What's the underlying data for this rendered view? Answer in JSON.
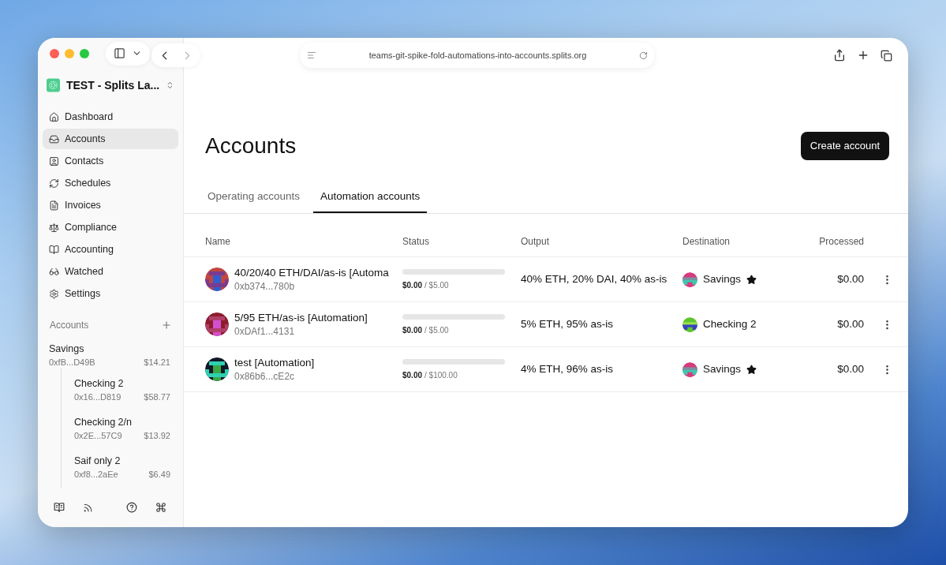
{
  "browser": {
    "url": "teams-git-spike-fold-automations-into-accounts.splits.org"
  },
  "workspace": {
    "name": "TEST - Splits La..."
  },
  "nav": [
    {
      "label": "Dashboard",
      "selected": false
    },
    {
      "label": "Accounts",
      "selected": true
    },
    {
      "label": "Contacts",
      "selected": false
    },
    {
      "label": "Schedules",
      "selected": false
    },
    {
      "label": "Invoices",
      "selected": false
    },
    {
      "label": "Compliance",
      "selected": false
    },
    {
      "label": "Accounting",
      "selected": false
    },
    {
      "label": "Watched",
      "selected": false
    },
    {
      "label": "Settings",
      "selected": false
    }
  ],
  "accounts_section": {
    "title": "Accounts",
    "items": [
      {
        "name": "Savings",
        "address": "0xfB...D49B",
        "balance": "$14.21",
        "children": [
          {
            "name": "Checking 2",
            "address": "0x16...D819",
            "balance": "$58.77"
          },
          {
            "name": "Checking 2/n",
            "address": "0x2E...57C9",
            "balance": "$13.92"
          },
          {
            "name": "Saif only 2",
            "address": "0xf8...2aEe",
            "balance": "$6.49"
          }
        ]
      }
    ]
  },
  "page": {
    "title": "Accounts",
    "primary_button": "Create account"
  },
  "tabs": [
    {
      "label": "Operating accounts",
      "selected": false
    },
    {
      "label": "Automation accounts",
      "selected": true
    }
  ],
  "table": {
    "columns": [
      "Name",
      "Status",
      "Output",
      "Destination",
      "Processed"
    ],
    "rows": [
      {
        "name": "40/20/40 ETH/DAI/as-is [Automa",
        "address": "0xb374...780b",
        "spent": "$0.00",
        "limit": "/ $5.00",
        "level": 0,
        "output": "40% ETH, 20% DAI, 40% as-is",
        "destination": "Savings",
        "starred": true,
        "processed": "$0.00"
      },
      {
        "name": "5/95 ETH/as-is [Automation]",
        "address": "0xDAf1...4131",
        "spent": "$0.00",
        "limit": "/ $5.00",
        "level": 0,
        "output": "5% ETH, 95% as-is",
        "destination": "Checking 2",
        "starred": false,
        "processed": "$0.00"
      },
      {
        "name": "test [Automation]",
        "address": "0x86b6...cE2c",
        "spent": "$0.00",
        "limit": "/ $100.00",
        "level": 0,
        "output": "4% ETH, 96% as-is",
        "destination": "Savings",
        "starred": true,
        "processed": "$0.00"
      }
    ]
  }
}
